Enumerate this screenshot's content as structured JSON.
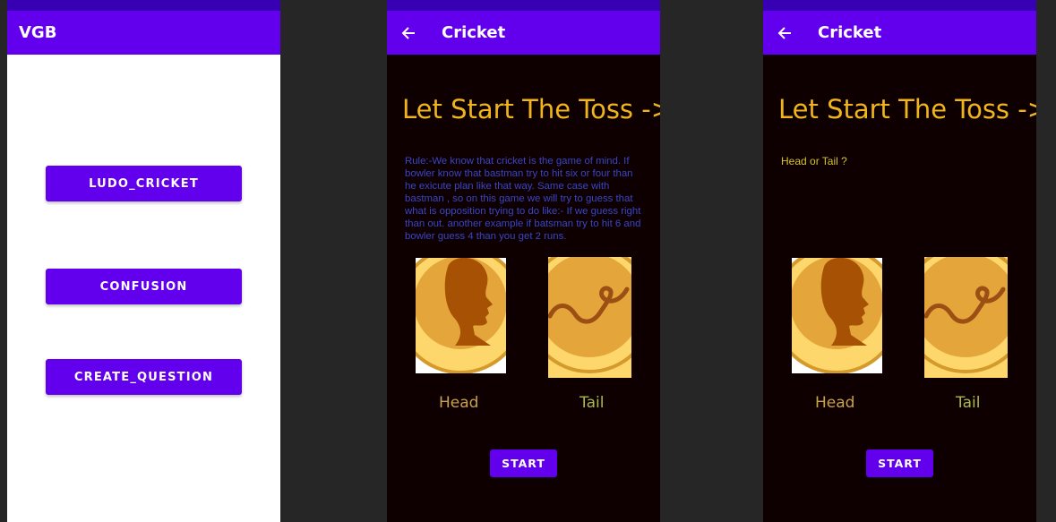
{
  "colors": {
    "status_bar": "#3700b3",
    "app_bar": "#6200ee",
    "button": "#6200ee",
    "title_gold": "#f0b51d",
    "rule_text": "#3a44c9",
    "dark_bg": "#0e0000"
  },
  "screen_menu": {
    "app_title": "VGB",
    "buttons": [
      "LUDO_CRICKET",
      "CONFUSION",
      "CREATE_QUESTION"
    ]
  },
  "screen_rules": {
    "app_title": "Cricket",
    "back_icon": "arrow-left-icon",
    "heading": "Let Start The Toss ->",
    "rule": "Rule:-We know that cricket is the game of mind. If bowler know that bastman try to hit six or four than he exicute plan like that way. Same case with bastman , so on this game we will try to guess that what is opposition trying to do like:- If we guess right than out. another example if batsman try to hit 6 and bowler guess 4 than you get 2 runs.",
    "head_label": "Head",
    "tail_label": "Tail",
    "start_label": "START"
  },
  "screen_question": {
    "app_title": "Cricket",
    "back_icon": "arrow-left-icon",
    "heading": "Let Start The Toss ->",
    "question": "Head or Tail ?",
    "head_label": "Head",
    "tail_label": "Tail",
    "start_label": "START"
  }
}
